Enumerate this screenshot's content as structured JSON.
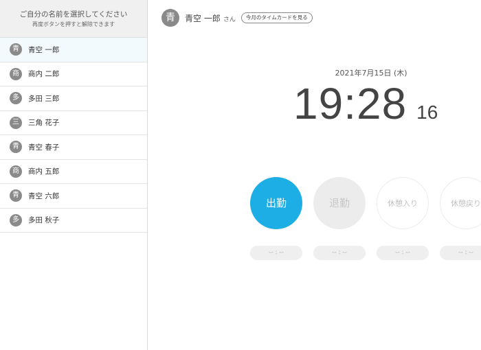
{
  "sidebar": {
    "header_line1": "ご自分の名前を選択してください",
    "header_line2": "再度ボタンを押すと解除できます",
    "employees": [
      {
        "initial": "青",
        "name": "青空 一郎"
      },
      {
        "initial": "商",
        "name": "商内 二郎"
      },
      {
        "initial": "多",
        "name": "多田 三郎"
      },
      {
        "initial": "三",
        "name": "三角 花子"
      },
      {
        "initial": "青",
        "name": "青空 春子"
      },
      {
        "initial": "商",
        "name": "商内 五郎"
      },
      {
        "initial": "青",
        "name": "青空 六郎"
      },
      {
        "initial": "多",
        "name": "多田 秋子"
      }
    ]
  },
  "header": {
    "initial": "青",
    "name": "青空 一郎",
    "honorific": "さん",
    "timecard_link": "今月のタイムカードを見る"
  },
  "clock": {
    "date": "2021年7月15日 (木)",
    "hours_minutes": "19:28",
    "seconds": "16"
  },
  "actions": [
    {
      "label": "出勤",
      "time": "-- : --"
    },
    {
      "label": "退勤",
      "time": "-- : --"
    },
    {
      "label": "休憩入り",
      "time": "-- : --"
    },
    {
      "label": "休憩戻り",
      "time": "-- : --"
    }
  ]
}
